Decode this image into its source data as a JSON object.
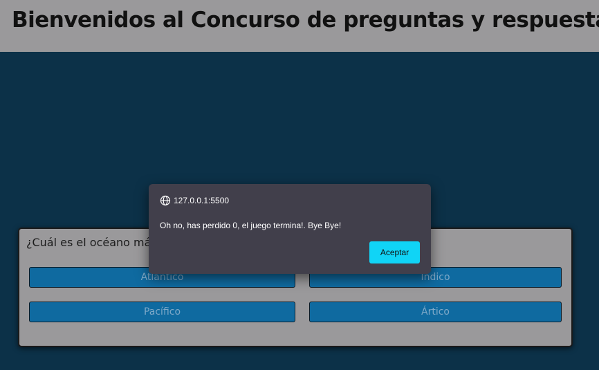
{
  "header": {
    "title": "Bienvenidos al Concurso de preguntas y respuestas"
  },
  "quiz": {
    "question": "¿Cuál es el océano más",
    "answers": [
      "Atlántico",
      "Índico",
      "Pacífico",
      "Ártico"
    ]
  },
  "dialog": {
    "origin": "127.0.0.1:5500",
    "message": "Oh no, has perdido 0, el juego termina!. Bye Bye!",
    "ok_label": "Aceptar",
    "origin_icon": "globe-icon"
  },
  "colors": {
    "header_bg": "#9a999b",
    "page_bg": "#0c3148",
    "answer_bg": "#0f6aa0",
    "dialog_bg": "#413f4b",
    "accent": "#10d4f6"
  }
}
